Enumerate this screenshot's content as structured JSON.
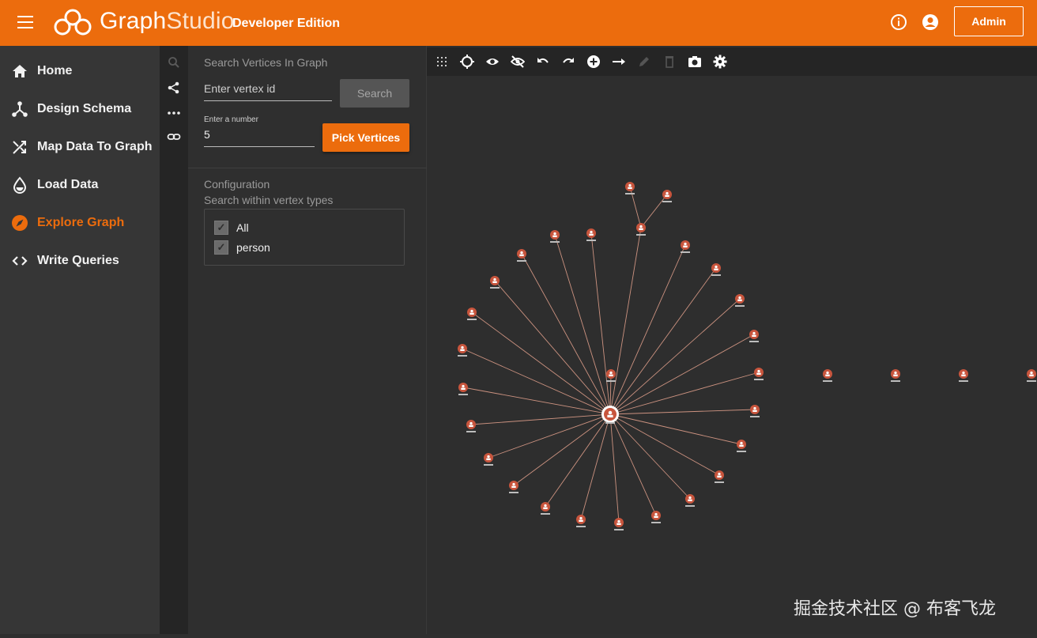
{
  "header": {
    "brand_primary": "Graph",
    "brand_secondary": "Studio",
    "edition": "Developer Edition",
    "admin_label": "Admin",
    "accent": "#ec6c0d"
  },
  "sidebar": {
    "items": [
      {
        "label": "Home",
        "icon": "home-icon",
        "active": false
      },
      {
        "label": "Design Schema",
        "icon": "schema-icon",
        "active": false
      },
      {
        "label": "Map Data To Graph",
        "icon": "shuffle-icon",
        "active": false
      },
      {
        "label": "Load Data",
        "icon": "drop-icon",
        "active": false
      },
      {
        "label": "Explore Graph",
        "icon": "compass-icon",
        "active": true
      },
      {
        "label": "Write Queries",
        "icon": "code-icon",
        "active": false
      }
    ]
  },
  "panel": {
    "search_title": "Search Vertices In Graph",
    "vertex_placeholder": "Enter vertex id",
    "search_button": "Search",
    "number_label": "Enter a number",
    "number_value": "5",
    "pick_button": "Pick Vertices",
    "config_title": "Configuration",
    "config_subtitle": "Search within vertex types",
    "vertex_types": [
      {
        "label": "All",
        "checked": true
      },
      {
        "label": "person",
        "checked": true
      }
    ]
  },
  "toolbar": {
    "icons": [
      "grid-icon",
      "locate-icon",
      "eye-icon",
      "eye-off-icon",
      "undo-icon",
      "redo-icon",
      "add-vertex-icon",
      "add-edge-icon",
      "edit-icon",
      "delete-icon",
      "camera-icon",
      "settings-icon"
    ]
  },
  "graph": {
    "node_color": "#c8553d",
    "edge_color": "#e8a48f"
  },
  "watermark": "掘金技术社区 @ 布客飞龙"
}
